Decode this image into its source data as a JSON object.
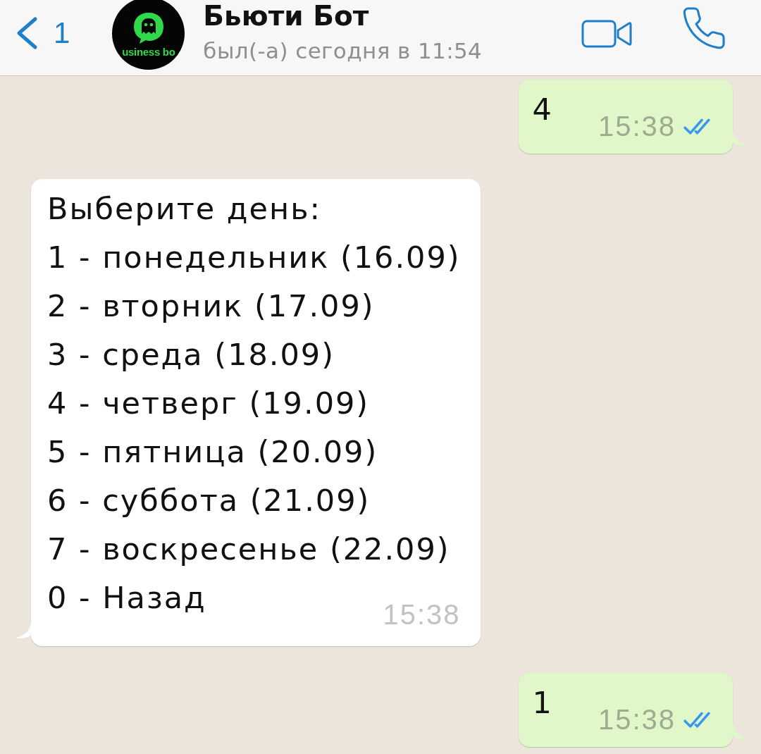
{
  "header": {
    "back_count": "1",
    "avatar_text": "usiness bo",
    "title": "Бьюти Бот",
    "status": "был(-а) сегодня в 11:54"
  },
  "messages": [
    {
      "kind": "outgoing",
      "lines": [
        "4"
      ],
      "time": "15:38",
      "read": true
    },
    {
      "kind": "incoming",
      "lines": [
        "Выберите день:",
        "1 - понедельник (16.09)",
        "2 - вторник (17.09)",
        "3 - среда (18.09)",
        "4 - четверг (19.09)",
        "5 - пятница (20.09)",
        "6 - суббота (21.09)",
        "7 - воскресенье (22.09)",
        "0 - Назад"
      ],
      "time": "15:38"
    },
    {
      "kind": "outgoing",
      "lines": [
        "1"
      ],
      "time": "15:38",
      "read": true
    }
  ]
}
